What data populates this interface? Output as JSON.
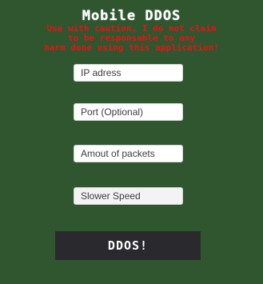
{
  "app": {
    "title": "Mobile DDOS",
    "warning_lines": [
      "Use with caution, I do not claim",
      "to be responsable to any",
      "harm done using this application!"
    ]
  },
  "form": {
    "ip_placeholder": "IP adress",
    "port_placeholder": "Port (Optional)",
    "packets_placeholder": "Amout of packets",
    "speed_placeholder": "Slower Speed"
  },
  "actions": {
    "ddos_label": "DDOS!"
  },
  "colors": {
    "background": "#2f562f",
    "warning": "#e61414",
    "button": "#2a2a2e"
  }
}
